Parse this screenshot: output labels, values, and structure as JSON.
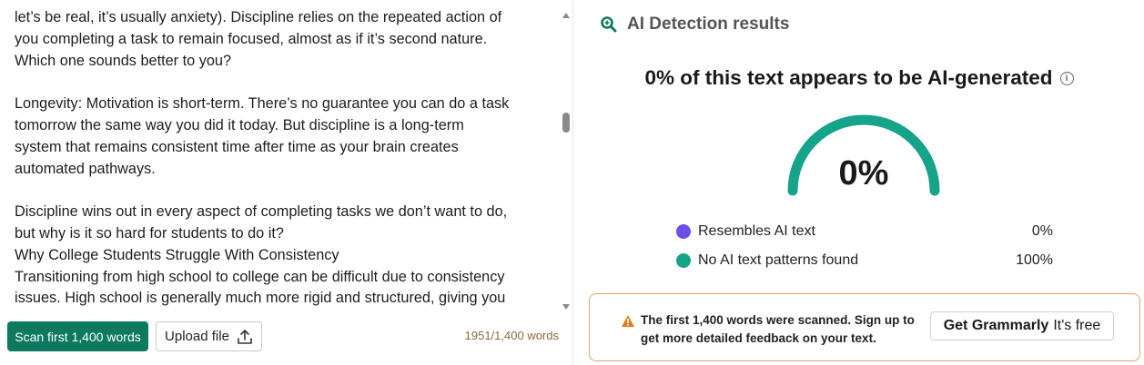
{
  "editor": {
    "lines": [
      "let’s be real, it’s usually anxiety). Discipline relies on the repeated action of",
      "you completing a task to remain focused, almost as if it’s second nature.",
      "Which one sounds better to you?",
      "",
      "Longevity: Motivation is short-term. There’s no guarantee you can do a task",
      "tomorrow the same way you did it today. But discipline is a long-term",
      "system that remains consistent time after time as your brain creates",
      "automated pathways.",
      "",
      "Discipline wins out in every aspect of completing tasks we don’t want to do,",
      "but why is it so hard for students to do it?",
      "Why College Students Struggle With Consistency",
      "Transitioning from high school to college can be difficult due to consistency",
      "issues. High school is generally much more rigid and structured, giving you"
    ],
    "scan_button": "Scan first 1,400 words",
    "upload_button": "Upload file",
    "word_count": "1951/1,400 words"
  },
  "results": {
    "header_title": "AI Detection results",
    "headline": "0% of this text appears to be AI-generated",
    "percent": "0%",
    "ai_fraction": 0,
    "legend": [
      {
        "label": "Resembles AI text",
        "value": "0%",
        "color": "#6b4ee6"
      },
      {
        "label": "No AI text patterns found",
        "value": "100%",
        "color": "#15a38a"
      }
    ],
    "gauge_color": "#15a38a",
    "notice": {
      "text": "The first 1,400 words were scanned. Sign up to get more detailed feedback on your text.",
      "cta_bold": "Get Grammarly",
      "cta_rest": "It's free",
      "warning_color": "#e67a1e"
    }
  }
}
